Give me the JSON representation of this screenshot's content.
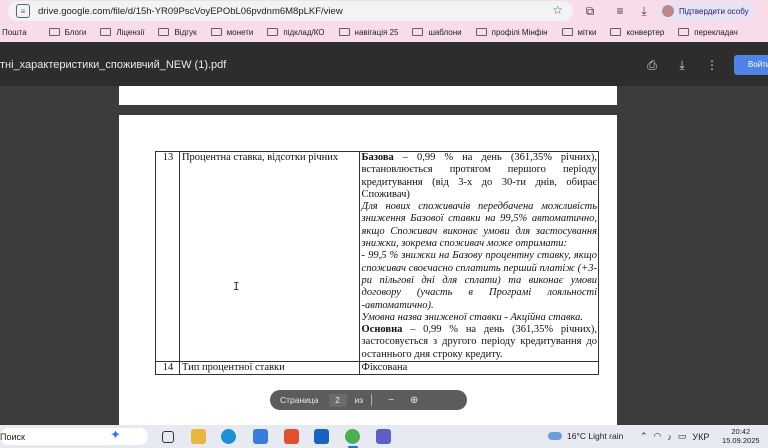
{
  "browser": {
    "url": "drive.google.com/file/d/15h-YR09PscVoyEPObL06pvdnm6M8pLKF/view",
    "profile_label": "Підтвердити особу"
  },
  "bookmarks": [
    {
      "label": "Пошта"
    },
    {
      "label": "Блоги"
    },
    {
      "label": "Ліцензії"
    },
    {
      "label": "Відгук"
    },
    {
      "label": "монети"
    },
    {
      "label": "підклад/КО"
    },
    {
      "label": "навігація 25"
    },
    {
      "label": "шаблони"
    },
    {
      "label": "профілі Мінфін"
    },
    {
      "label": "мітки"
    },
    {
      "label": "конвертер"
    },
    {
      "label": "перекладач"
    }
  ],
  "viewer": {
    "title": "тні_характеристики_споживчий_NEW (1).pdf",
    "login_label": "Войти"
  },
  "document": {
    "rows": [
      {
        "num": "13",
        "name": "Процентна ставка, відсотки річних",
        "base_bold": "Базова",
        "base_text": " – 0,99 % на день (361,35% річних), встановлюється протягом першого періоду кредитування (від 3-х до 30-ти днів, обирає Споживач)",
        "italic_p1": "Для нових споживачів передбачена можливість зниження Базової ставки на 99,5% автоматично, якщо Споживач виконає умови для застосування знижки, зокрема споживач може отримати:",
        "italic_p2": "-      99,5 % знижки на Базову процентну ставку, якщо споживач своєчасно сплатить перший платіж (+3-ри пільгові дні для сплати) та виконає умови договору (участь в Програмі лояльності -автоматично).",
        "italic_p3": "Умовна назва зниженої ставки -  Акційна ставка.",
        "main_bold": "Основна",
        "main_text": " – 0,99 % на день (361,35% річних), застосовується з другого періоду кредитування до останнього дня строку кредиту."
      },
      {
        "num": "14",
        "name": "Тип процентної ставки",
        "value": "Фіксована"
      }
    ]
  },
  "pagenav": {
    "label": "Страница",
    "current": "2",
    "of": "из"
  },
  "taskbar": {
    "search_placeholder": "Поиск",
    "weather": "16°C  Light rain",
    "lang": "УКР",
    "time": "20:42",
    "date": "15.09.2025"
  }
}
